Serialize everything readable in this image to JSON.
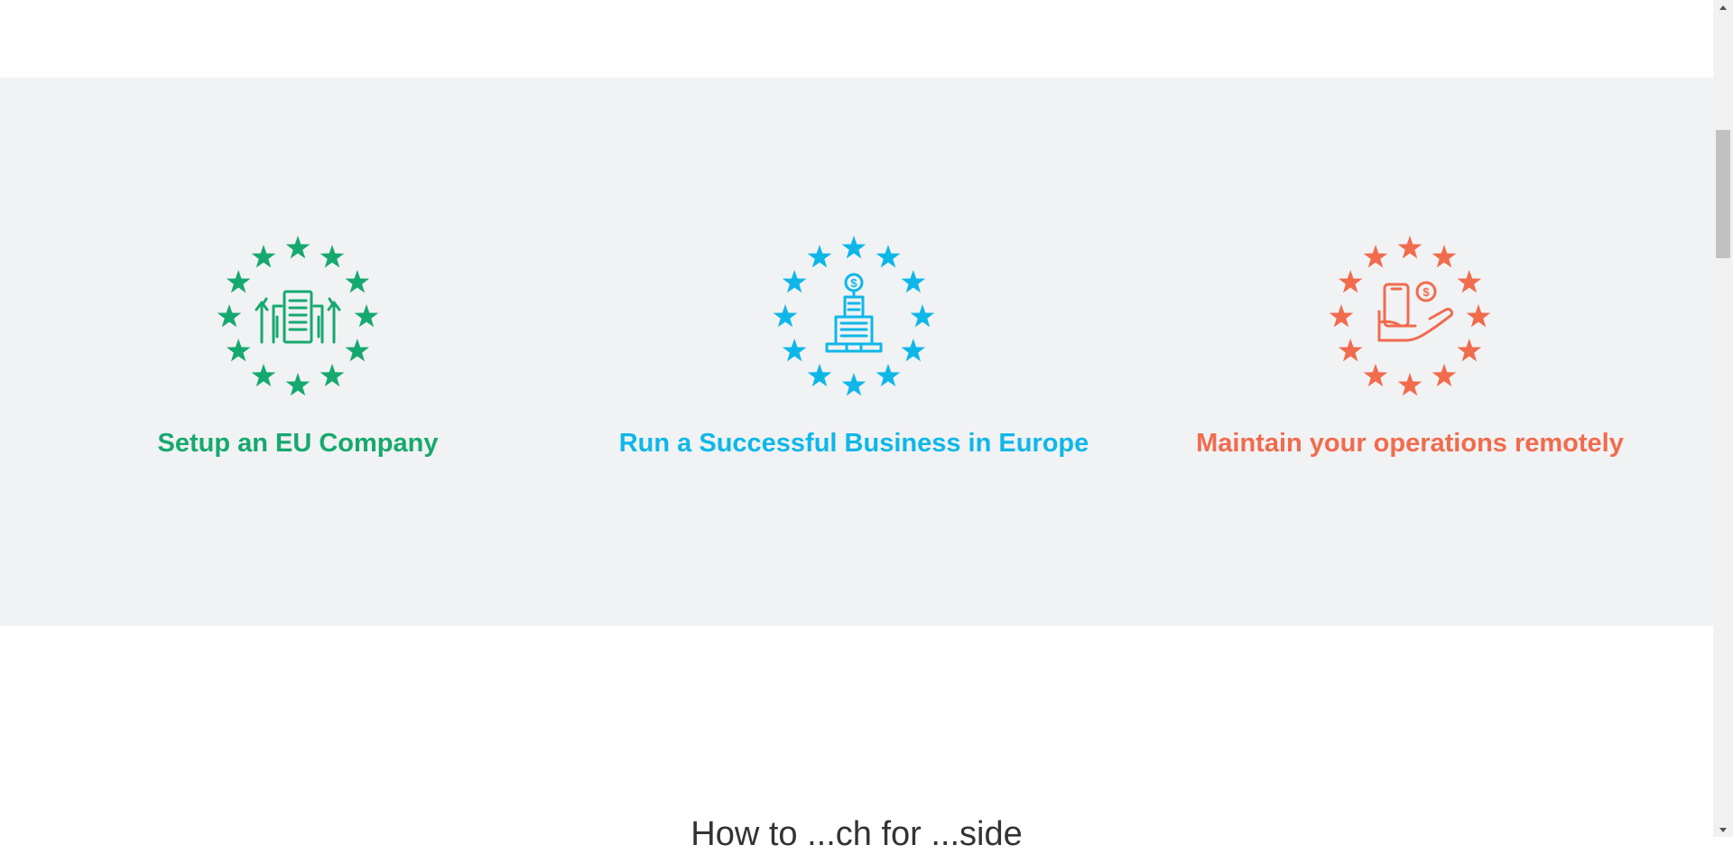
{
  "colors": {
    "band_background": "#f1f2f4",
    "green": "#16a96f",
    "blue": "#0fb7e8",
    "orange": "#f16b4d"
  },
  "features": [
    {
      "title": "Setup an EU Company",
      "icon": "eu-stars-buildings-growth-icon",
      "color": "#16a96f"
    },
    {
      "title": "Run a Successful Business in Europe",
      "icon": "eu-stars-office-tower-dollar-icon",
      "color": "#0fb7e8"
    },
    {
      "title": "Maintain your operations remotely",
      "icon": "eu-stars-hand-phone-dollar-icon",
      "color": "#f16b4d"
    }
  ],
  "next_section": {
    "heading_partial": "How to ...ch for ...side"
  }
}
